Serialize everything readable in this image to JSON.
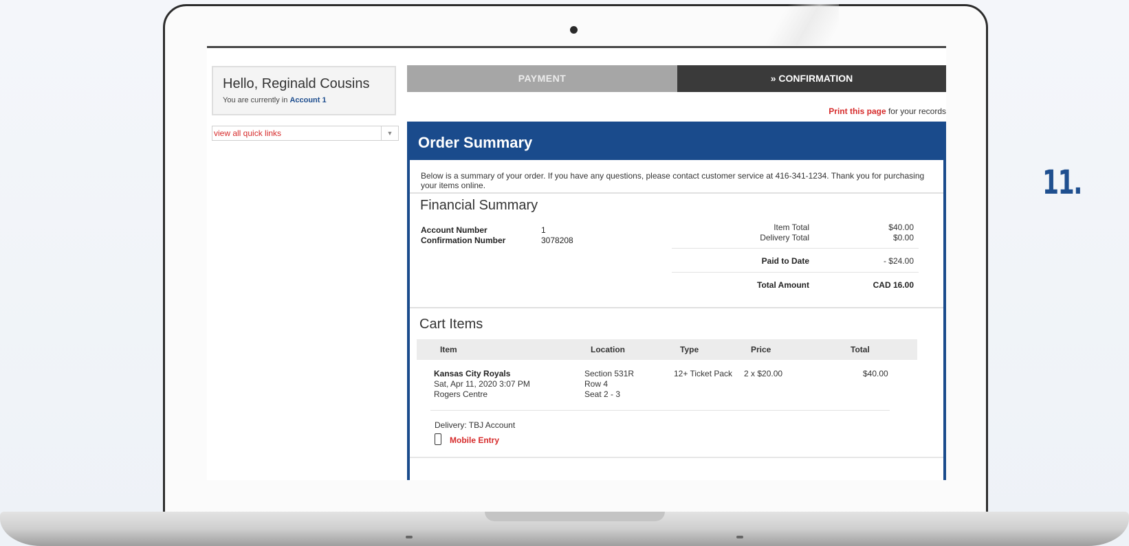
{
  "step_number": "11.",
  "sidebar": {
    "greeting": "Hello, Reginald Cousins",
    "account_prefix": "You are currently in",
    "account_name": "Account 1",
    "quicklinks_label": "view all quick links"
  },
  "tabs": {
    "payment": "PAYMENT",
    "confirmation": "» CONFIRMATION"
  },
  "print": {
    "link": "Print this page",
    "suffix": " for your records"
  },
  "order": {
    "title": "Order Summary",
    "intro": "Below is a summary of your order. If you have any questions, please contact customer service at 416-341-1234. Thank you for purchasing your items online.",
    "financial_title": "Financial Summary",
    "account_number_label": "Account Number",
    "account_number": "1",
    "confirmation_label": "Confirmation Number",
    "confirmation_number": "3078208",
    "item_total_label": "Item Total",
    "item_total": "$40.00",
    "delivery_total_label": "Delivery Total",
    "delivery_total": "$0.00",
    "paid_label": "Paid to Date",
    "paid": "- $24.00",
    "total_label": "Total Amount",
    "total": "CAD 16.00"
  },
  "cart": {
    "title": "Cart Items",
    "headers": {
      "item": "Item",
      "location": "Location",
      "type": "Type",
      "price": "Price",
      "total": "Total"
    },
    "row": {
      "event": "Kansas City Royals",
      "datetime": "Sat, Apr 11, 2020 3:07 PM",
      "venue": "Rogers Centre",
      "section": "Section 531R",
      "row": "Row 4",
      "seat": "Seat 2 - 3",
      "type": "12+ Ticket Pack",
      "price": "2 x $20.00",
      "total": "$40.00"
    },
    "delivery": "Delivery: TBJ Account",
    "mobile_entry": "Mobile Entry"
  }
}
